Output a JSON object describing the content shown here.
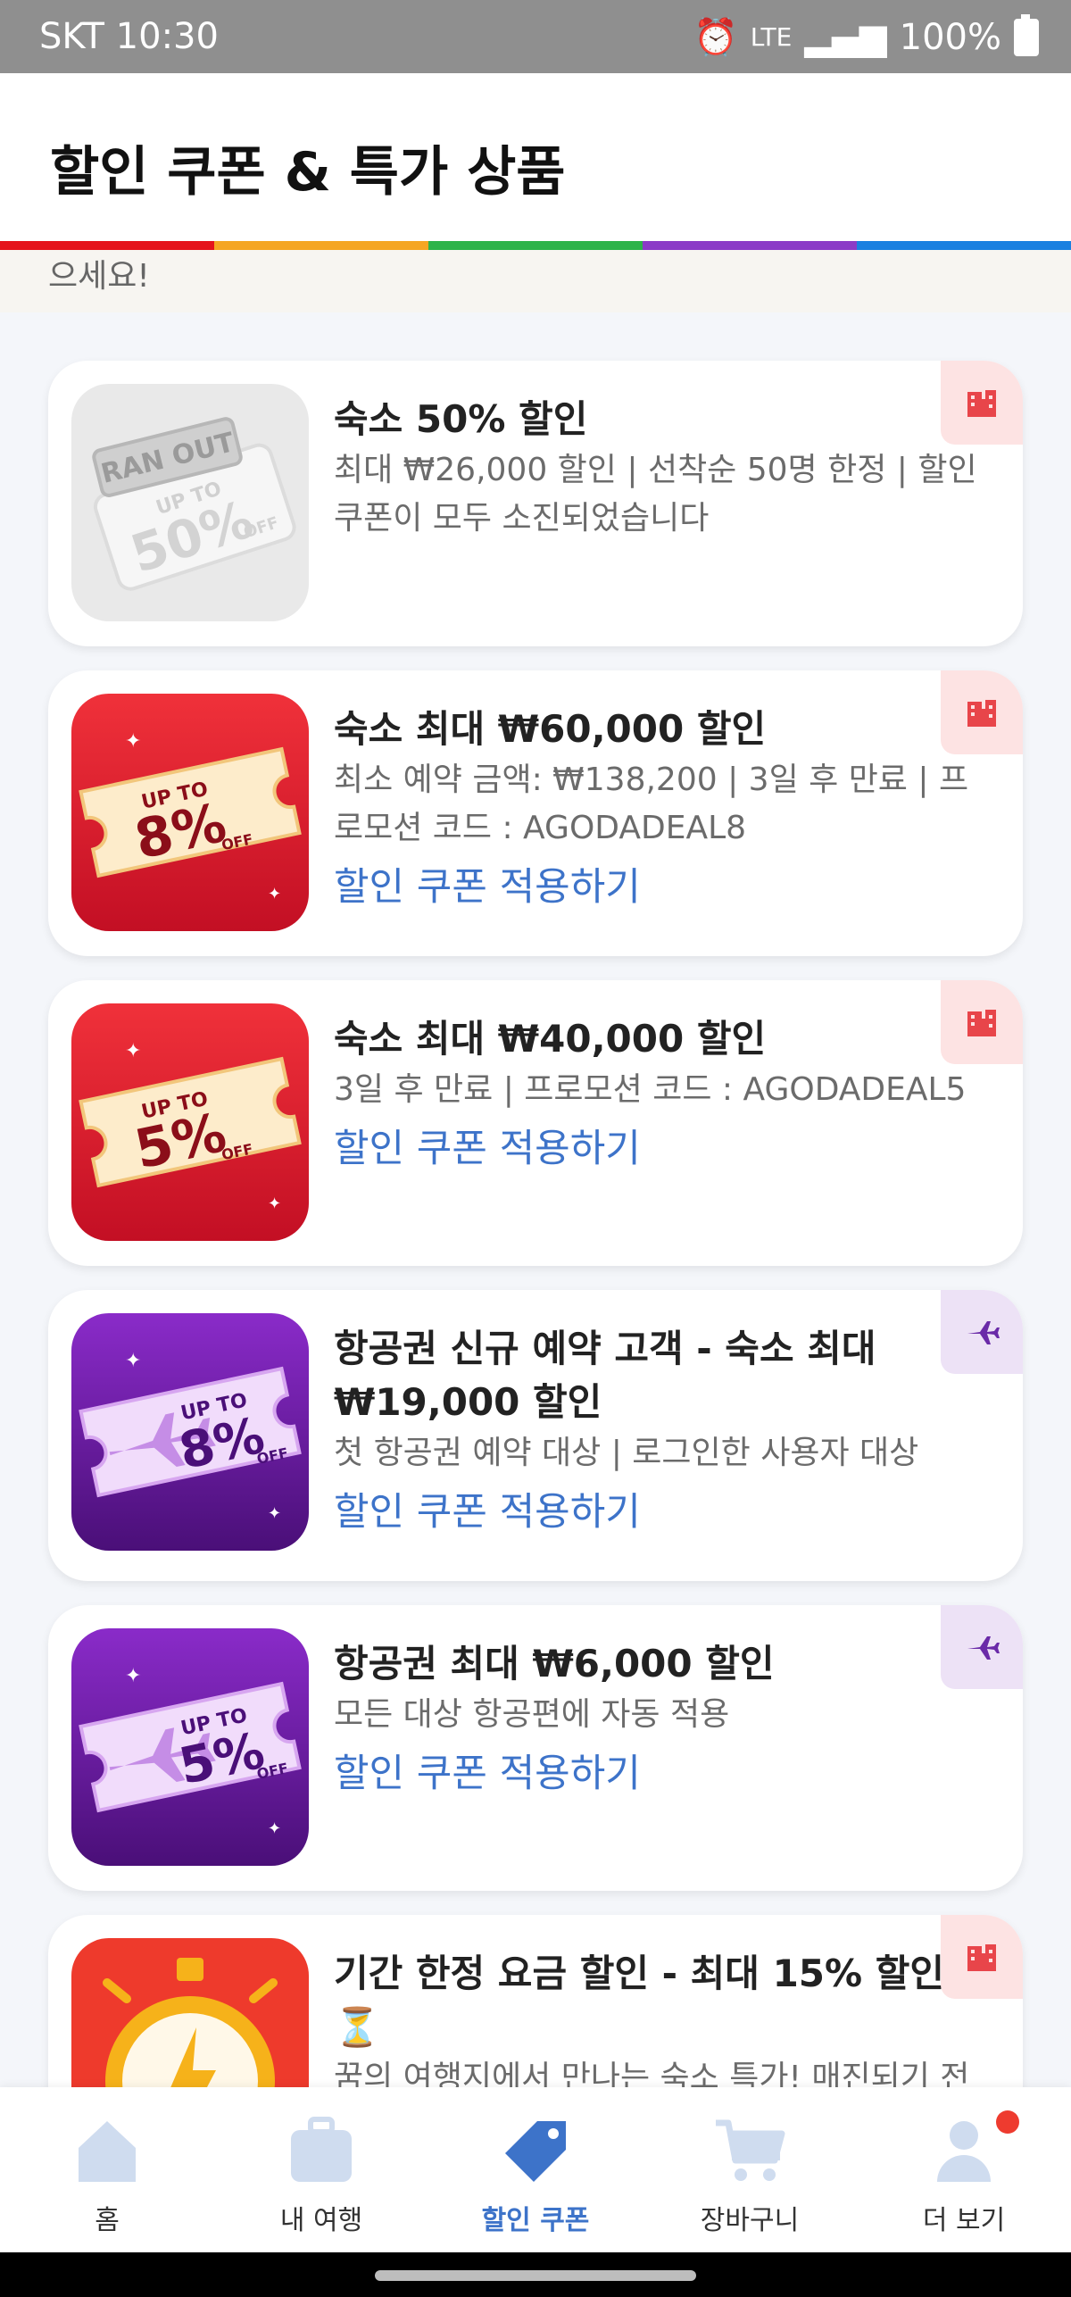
{
  "status_bar": {
    "carrier_time": "SKT 10:30",
    "network": "LTE",
    "battery": "100%"
  },
  "header": {
    "title": "할인 쿠폰 & 특가 상품"
  },
  "rainbow_colors": [
    "#e5141c",
    "#f5a623",
    "#2db34a",
    "#8b3bc7",
    "#1a80e0"
  ],
  "greeting": "으세요!",
  "coupons": [
    {
      "title": "숙소 50% 할인",
      "desc": "최대 ₩26,000 할인 | 선착순 50명 한정 | 할인 쿠폰이 모두 소진되었습니다",
      "apply": "",
      "badge": "hotel-icon",
      "thumb": {
        "style": "ran-out",
        "stamp": "RAN OUT",
        "up_to": "UP TO",
        "percent": "50%",
        "off": "OFF"
      }
    },
    {
      "title": "숙소 최대 ₩60,000 할인",
      "desc": "최소 예약 금액: ₩138,200 | 3일 후 만료 | 프로모션 코드 : AGODADEAL8",
      "apply": "할인 쿠폰 적용하기",
      "badge": "hotel-icon",
      "thumb": {
        "style": "red-ticket",
        "up_to": "UP TO",
        "percent": "8%",
        "off": "OFF"
      }
    },
    {
      "title": "숙소 최대 ₩40,000 할인",
      "desc": "3일 후 만료 | 프로모션 코드 : AGODADEAL5",
      "apply": "할인 쿠폰 적용하기",
      "badge": "hotel-icon",
      "thumb": {
        "style": "red-ticket",
        "up_to": "UP TO",
        "percent": "5%",
        "off": "OFF"
      }
    },
    {
      "title": "항공권 신규 예약 고객 - 숙소 최대 ₩19,000 할인",
      "desc": "첫 항공권 예약 대상 | 로그인한 사용자 대상",
      "apply": "할인 쿠폰 적용하기",
      "badge": "airplane-icon",
      "thumb": {
        "style": "purple-ticket",
        "up_to": "UP TO",
        "percent": "8%",
        "off": "OFF"
      }
    },
    {
      "title": "항공권 최대 ₩6,000 할인",
      "desc": "모든 대상 항공편에 자동 적용",
      "apply": "할인 쿠폰 적용하기",
      "badge": "airplane-icon",
      "thumb": {
        "style": "stopwatch-placeholder",
        "up_to": "UP TO",
        "percent": "5%",
        "off": "OFF"
      }
    },
    {
      "title": "기간 한정 요금 할인 - 최대 15% 할인 ⏳",
      "desc": "꿈의 여행지에서 만나는 숙소 특가! 매진되기 전",
      "apply": "",
      "badge": "hotel-icon",
      "thumb": {
        "style": "stopwatch"
      }
    }
  ],
  "nav": [
    {
      "label": "홈",
      "icon": "home-icon",
      "active": false
    },
    {
      "label": "내 여행",
      "icon": "suitcase-icon",
      "active": false
    },
    {
      "label": "할인 쿠폰",
      "icon": "tag-icon",
      "active": true
    },
    {
      "label": "장바구니",
      "icon": "cart-icon",
      "active": false
    },
    {
      "label": "더 보기",
      "icon": "profile-icon",
      "active": false
    }
  ],
  "colors": {
    "accent": "#3d73c9",
    "red_card": "#d7142a",
    "purple_card": "#5e1490",
    "notification_dot": "#ee3b2f"
  }
}
